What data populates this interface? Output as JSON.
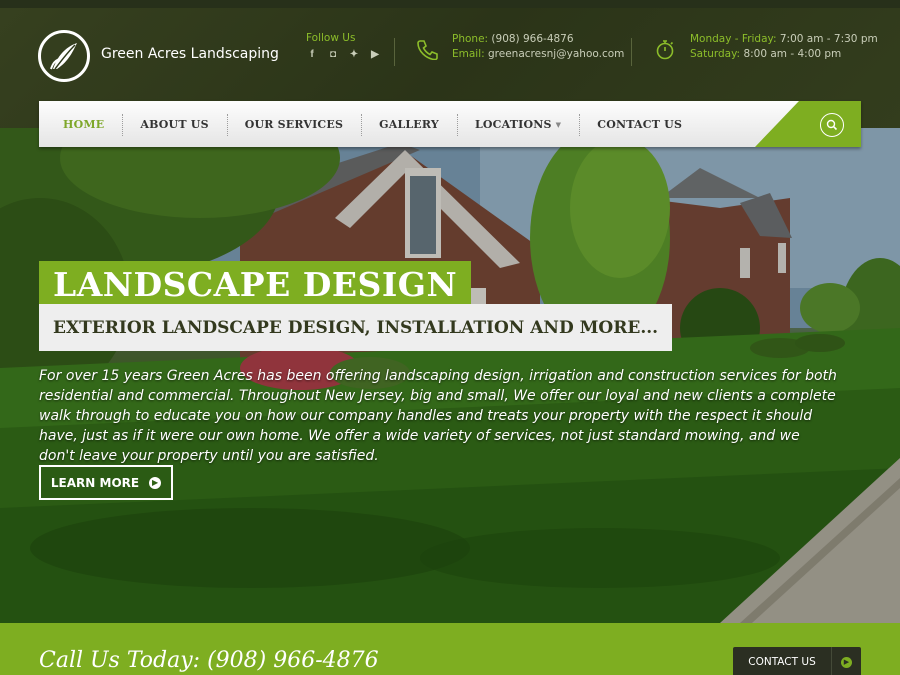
{
  "brand": {
    "name": "Green Acres Landscaping",
    "logo_icon": "leaf-logo-icon"
  },
  "header": {
    "follow_label": "Follow Us",
    "social": [
      {
        "icon": "facebook-icon",
        "glyph": "f"
      },
      {
        "icon": "instagram-icon",
        "glyph": "◘"
      },
      {
        "icon": "twitter-icon",
        "glyph": "✦"
      },
      {
        "icon": "youtube-icon",
        "glyph": "▶"
      }
    ],
    "phone_label": "Phone:",
    "phone_value": "(908) 966-4876",
    "email_label": "Email:",
    "email_value": "greenacresnj@yahoo.com",
    "weekday_label": "Monday - Friday:",
    "weekday_hours": "7:00 am - 7:30 pm",
    "saturday_label": "Saturday:",
    "saturday_hours": "8:00 am - 4:00 pm"
  },
  "nav": {
    "items": [
      "HOME",
      "ABOUT US",
      "OUR SERVICES",
      "GALLERY",
      "LOCATIONS",
      "CONTACT US"
    ],
    "active_index": 0
  },
  "hero": {
    "title": "LANDSCAPE DESIGN",
    "subtitle": "EXTERIOR LANDSCAPE DESIGN, INSTALLATION AND MORE...",
    "body": "For over 15 years Green Acres has been offering landscaping design, irrigation and construction services for both residential and commercial. Throughout New Jersey, big and small, We offer our loyal and new clients a complete walk through to educate you on how our company handles and treats your property with the respect it should have, just as if it were our own home. We offer a wide variety of services, not just standard mowing, and we don't leave your property until you are satisfied.",
    "cta_label": "LEARN MORE"
  },
  "callbar": {
    "text": "Call Us Today: (908) 966-4876",
    "button_label": "CONTACT US"
  },
  "colors": {
    "accent": "#7eae21",
    "header_bg": "#2f3a1c",
    "accent_text": "#8cbd2a"
  }
}
